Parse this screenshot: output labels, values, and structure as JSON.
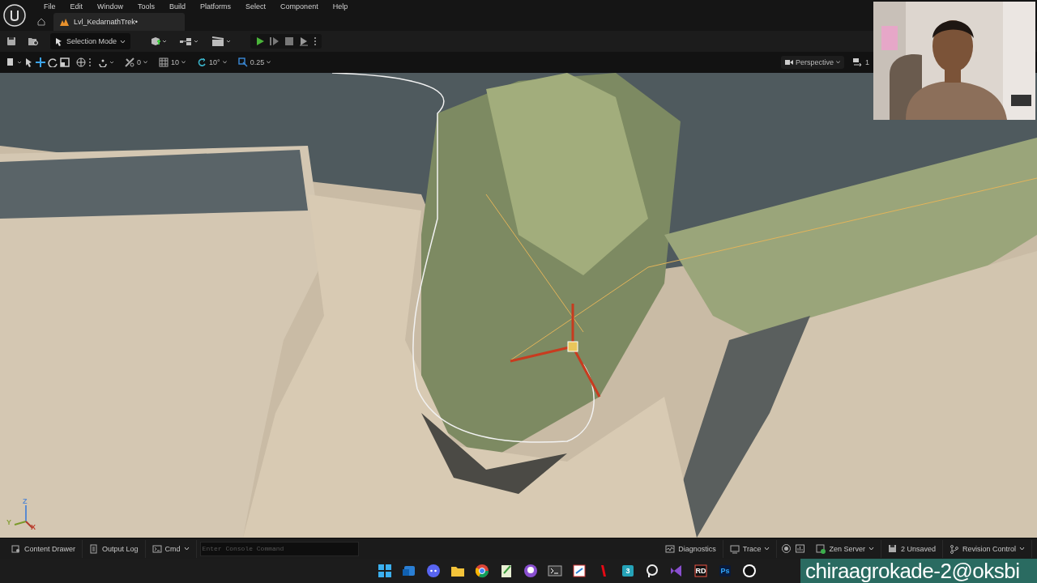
{
  "menu": [
    "File",
    "Edit",
    "Window",
    "Tools",
    "Build",
    "Platforms",
    "Select",
    "Component",
    "Help"
  ],
  "level_tab": {
    "label": "Lvl_KedarnathTrek•",
    "selected": true
  },
  "toolbar": {
    "mode": "Selection Mode"
  },
  "viewport_toolbar": {
    "snaps": [
      {
        "kind": "translate",
        "value": "0"
      },
      {
        "kind": "grid",
        "value": "10"
      },
      {
        "kind": "rotate",
        "value": "10°"
      },
      {
        "kind": "scale",
        "value": "0.25"
      }
    ],
    "view": "Perspective",
    "camera_speed": "1"
  },
  "axis_labels": [
    "Z",
    "Y",
    "X"
  ],
  "status_bar": {
    "left": [
      {
        "kind": "drawer",
        "label": "Content Drawer"
      },
      {
        "kind": "log",
        "label": "Output Log"
      },
      {
        "kind": "cmd",
        "label": "Cmd"
      }
    ],
    "console": {
      "placeholder": "Enter Console Command"
    },
    "right": [
      {
        "kind": "diagnostics",
        "label": "Diagnostics"
      },
      {
        "kind": "trace",
        "label": "Trace"
      },
      {
        "kind": "zen",
        "label": "Zen Server"
      },
      {
        "kind": "unsaved",
        "label": "2 Unsaved"
      },
      {
        "kind": "revision",
        "label": "Revision Control"
      }
    ]
  },
  "taskbar": [
    {
      "kind": "start"
    },
    {
      "kind": "mail"
    },
    {
      "kind": "chat"
    },
    {
      "kind": "folder"
    },
    {
      "kind": "browser"
    },
    {
      "kind": "notes"
    },
    {
      "kind": "git"
    },
    {
      "kind": "terminal"
    },
    {
      "kind": "snip"
    },
    {
      "kind": "video"
    },
    {
      "kind": "max",
      "glyph": "3"
    },
    {
      "kind": "ring"
    },
    {
      "kind": "ide"
    },
    {
      "kind": "rider",
      "glyph": "RD"
    },
    {
      "kind": "ps",
      "glyph": "Ps"
    },
    {
      "kind": "engine"
    }
  ],
  "overlay_text": "chiraagrokade-2@oksbi"
}
